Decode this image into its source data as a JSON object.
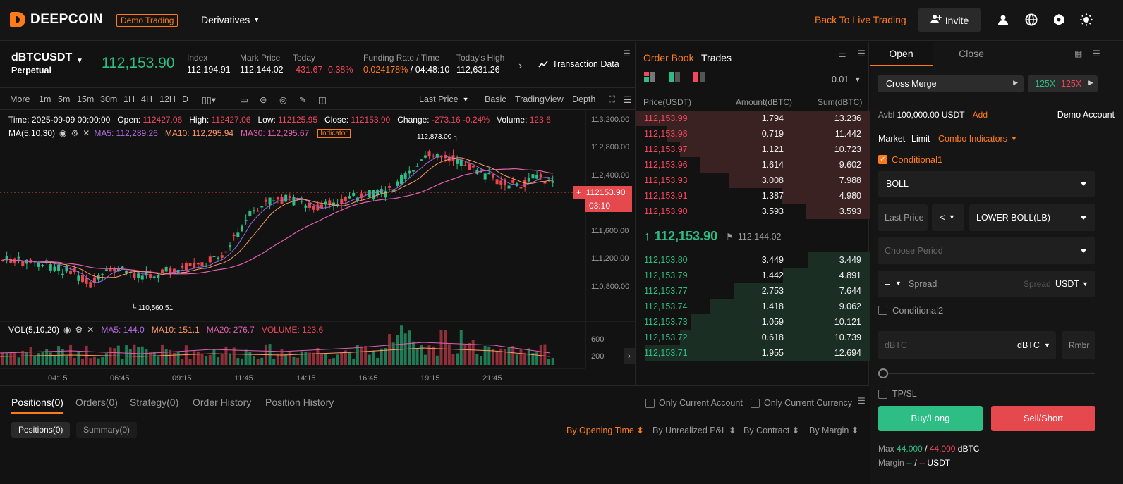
{
  "header": {
    "logo": "DEEPCOIN",
    "demo_badge": "Demo Trading",
    "derivatives": "Derivatives",
    "back_live": "Back To Live Trading",
    "invite": "Invite"
  },
  "ticker": {
    "symbol": "dBTCUSDT",
    "type": "Perpetual",
    "last": "112,153.90",
    "index_label": "Index",
    "index": "112,194.91",
    "mark_label": "Mark Price",
    "mark": "112,144.02",
    "today_label": "Today",
    "today": "-431.67 -0.38%",
    "funding_label": "Funding Rate / Time",
    "funding_rate": "0.024178%",
    "funding_time": "/ 04:48:10",
    "high_label": "Today's High",
    "high": "112,631.26",
    "txdata": "Transaction Data"
  },
  "chart_toolbar": {
    "intervals": [
      "More",
      "1m",
      "5m",
      "15m",
      "30m",
      "1H",
      "4H",
      "12H",
      "D"
    ],
    "active": "15m",
    "price_type": "Last Price",
    "views": [
      "Basic",
      "TradingView",
      "Depth"
    ]
  },
  "chart_info": {
    "time": "Time: 2025-09-09 00:00:00",
    "open_label": "Open:",
    "open": "112427.06",
    "high_label": "High:",
    "high": "112427.06",
    "low_label": "Low:",
    "low": "112125.95",
    "close_label": "Close:",
    "close": "112153.90",
    "change_label": "Change:",
    "change": "-273.16 -0.24%",
    "volume_label": "Volume:",
    "volume": "123.6",
    "ma_title": "MA(5,10,30)",
    "ma5": "MA5: 112,289.26",
    "ma10": "MA10: 112,295.94",
    "ma30": "MA30: 112,295.67",
    "indicator": "Indicator",
    "peak": "112,873.00",
    "trough": "110,560.51",
    "vol_title": "VOL(5,10,20)",
    "vma5": "MA5: 144.0",
    "vma10": "MA10: 151.1",
    "vma20": "MA20: 276.7",
    "vvol": "VOLUME: 123.6",
    "price_tag": "112153.90",
    "countdown": "03:10"
  },
  "chart_data": {
    "type": "candlestick",
    "y_ticks": [
      "113,200.00",
      "112,800.00",
      "112,400.00",
      "111,600.00",
      "111,200.00",
      "110,800.00"
    ],
    "vol_ticks": [
      "600",
      "200"
    ],
    "x_ticks": [
      "04:15",
      "06:45",
      "09:15",
      "11:45",
      "14:15",
      "16:45",
      "19:15",
      "21:45"
    ],
    "ylim": [
      110400,
      113300
    ]
  },
  "orderbook": {
    "tab_ob": "Order Book",
    "tab_trades": "Trades",
    "step": "0.01",
    "headers": [
      "Price(USDT)",
      "Amount(dBTC)",
      "Sum(dBTC)"
    ],
    "asks": [
      [
        "112,153.99",
        "1.794",
        "13.236"
      ],
      [
        "112,153.98",
        "0.719",
        "11.442"
      ],
      [
        "112,153.97",
        "1.121",
        "10.723"
      ],
      [
        "112,153.96",
        "1.614",
        "9.602"
      ],
      [
        "112,153.93",
        "3.008",
        "7.988"
      ],
      [
        "112,153.91",
        "1.387",
        "4.980"
      ],
      [
        "112,153.90",
        "3.593",
        "3.593"
      ]
    ],
    "mid": "112,153.90",
    "mid_mark": "112,144.02",
    "bids": [
      [
        "112,153.80",
        "3.449",
        "3.449"
      ],
      [
        "112,153.79",
        "1.442",
        "4.891"
      ],
      [
        "112,153.77",
        "2.753",
        "7.644"
      ],
      [
        "112,153.74",
        "1.418",
        "9.062"
      ],
      [
        "112,153.73",
        "1.059",
        "10.121"
      ],
      [
        "112,153.72",
        "0.618",
        "10.739"
      ],
      [
        "112,153.71",
        "1.955",
        "12.694"
      ]
    ]
  },
  "positions": {
    "tabs": [
      "Positions(0)",
      "Orders(0)",
      "Strategy(0)",
      "Order History",
      "Position History"
    ],
    "only_account": "Only Current Account",
    "only_currency": "Only Current Currency",
    "sub_tabs": [
      "Positions(0)",
      "Summary(0)"
    ],
    "sorts": [
      "By Opening Time",
      "By Unrealized P&L",
      "By Contract",
      "By Margin"
    ]
  },
  "panel": {
    "tab_open": "Open",
    "tab_close": "Close",
    "margin_mode": "Cross Merge",
    "lev_long": "125X",
    "lev_short": "125X",
    "avbl_label": "Avbl",
    "avbl": "100,000.00 USDT",
    "add": "Add",
    "account": "Demo Account",
    "order_types": [
      "Market",
      "Limit",
      "Combo Indicators"
    ],
    "cond1": "Conditional1",
    "indicator": "BOLL",
    "last_price": "Last Price",
    "op": "<",
    "band": "LOWER BOLL(LB)",
    "period_ph": "Choose Period",
    "dash": "–",
    "spread_ph": "Spread",
    "spread2": "Spread",
    "spread_unit": "USDT",
    "cond2": "Conditional2",
    "qty_ph": "dBTC",
    "qty_unit": "dBTC",
    "rmbr": "Rmbr",
    "tpsl": "TP/SL",
    "buy": "Buy/Long",
    "sell": "Sell/Short",
    "max_label": "Max",
    "max_long": "44.000",
    "max_sep": "/",
    "max_short": "44.000",
    "max_unit": "dBTC",
    "margin_label": "Margin",
    "margin_long": "--",
    "margin_sep": "/",
    "margin_short": "--",
    "margin_unit": "USDT"
  }
}
